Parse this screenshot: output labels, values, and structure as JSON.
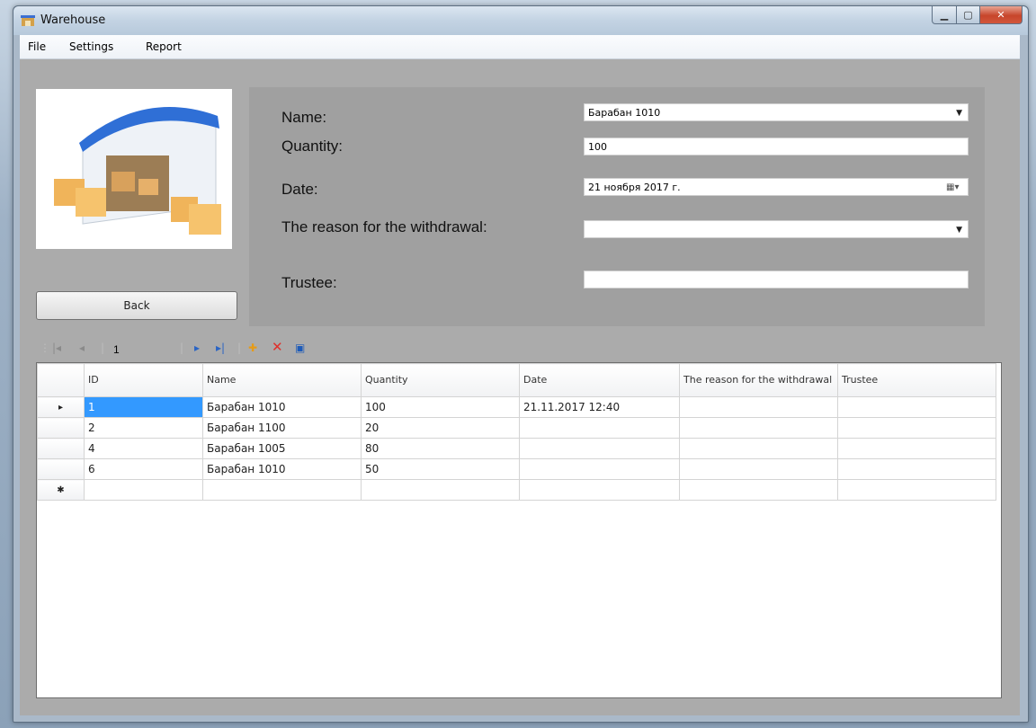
{
  "window": {
    "title": "Warehouse"
  },
  "menu": [
    {
      "label": "File"
    },
    {
      "label": "Settings"
    },
    {
      "label": "Report"
    }
  ],
  "image": {
    "alt": "warehouse-illustration"
  },
  "back_button": {
    "label": "Back"
  },
  "form": {
    "name": {
      "label": "Name:",
      "value": "Барабан 1010"
    },
    "quantity": {
      "label": "Quantity:",
      "value": "100"
    },
    "date": {
      "label": "Date:",
      "value": "21  ноября  2017 г."
    },
    "reason": {
      "label": "The reason for the withdrawal:",
      "value": ""
    },
    "trustee": {
      "label": "Trustee:",
      "value": ""
    }
  },
  "navigator": {
    "position": "1"
  },
  "grid": {
    "columns": [
      "ID",
      "Name",
      "Quantity",
      "Date",
      "The reason for the withdrawal",
      "Trustee"
    ],
    "rows": [
      {
        "id": "1",
        "name": "Барабан 1010",
        "quantity": "100",
        "date": "21.11.2017 12:40",
        "reason": "",
        "trustee": ""
      },
      {
        "id": "2",
        "name": "Барабан 1100",
        "quantity": "20",
        "date": "",
        "reason": "",
        "trustee": ""
      },
      {
        "id": "4",
        "name": "Барабан 1005",
        "quantity": "80",
        "date": "",
        "reason": "",
        "trustee": ""
      },
      {
        "id": "6",
        "name": "Барабан 1010",
        "quantity": "50",
        "date": "",
        "reason": "",
        "trustee": ""
      }
    ],
    "current_row_marker": "▸",
    "new_row_marker": "✱"
  },
  "colors": {
    "selected_cell": "#3399ff",
    "form_panel": "#a0a0a0",
    "client": "#ababab"
  }
}
